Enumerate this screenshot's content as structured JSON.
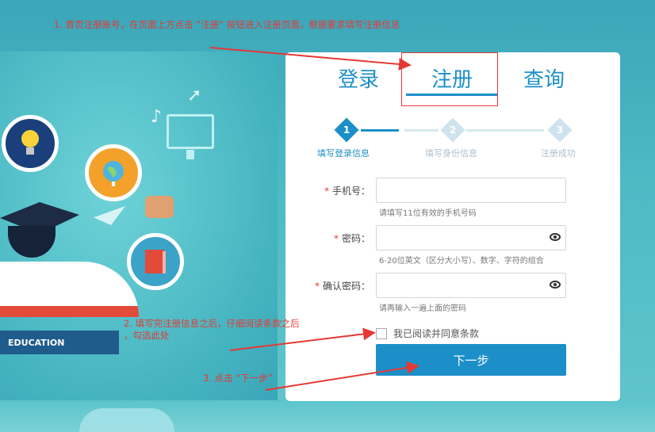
{
  "annotations": {
    "step1": "1. 首页注册账号，在页面上方点击 “注册” 按钮进入注册页面，根据要求填写注册信息",
    "step2_line1": "2. 填写完注册信息之后，仔细阅读条款之后",
    "step2_line2": "，勾选此处",
    "step3": "3. 点击 “下一步”"
  },
  "illustration": {
    "ribbon_text": "EDUCATION"
  },
  "tabs": [
    {
      "label": "登录"
    },
    {
      "label": "注册"
    },
    {
      "label": "查询"
    }
  ],
  "steps": [
    {
      "number": "1",
      "label": "填写登录信息",
      "active": true
    },
    {
      "number": "2",
      "label": "填写身份信息",
      "active": false
    },
    {
      "number": "3",
      "label": "注册成功",
      "active": false
    }
  ],
  "form": {
    "phone": {
      "label": "手机号：",
      "value": "",
      "hint": "请填写11位有效的手机号码"
    },
    "password": {
      "label": "密码：",
      "value": "",
      "hint": "6-20位英文（区分大小写）、数字、字符的组合"
    },
    "confirm": {
      "label": "确认密码：",
      "value": "",
      "hint": "请再输入一遍上面的密码"
    },
    "required_mark": "*",
    "agree_label": "我已阅读并同意条款",
    "next_label": "下一步"
  },
  "colors": {
    "accent": "#1d8fc8",
    "annotation": "#e53935"
  }
}
